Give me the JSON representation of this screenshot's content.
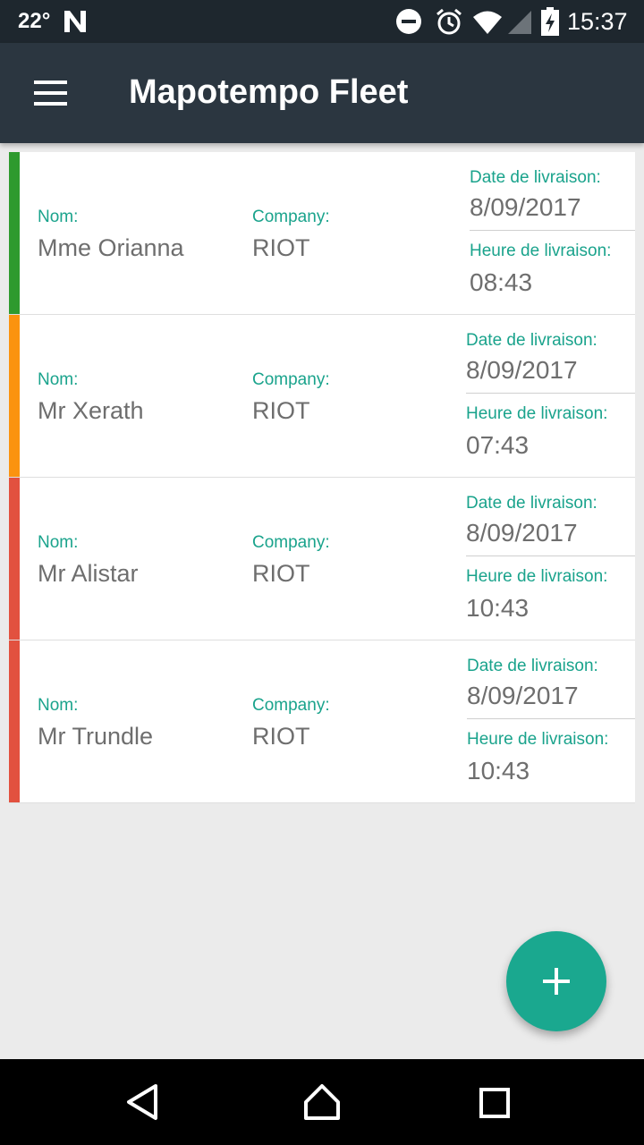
{
  "status_bar": {
    "temperature": "22°",
    "time": "15:37",
    "icons": [
      "n-icon",
      "do-not-disturb-icon",
      "alarm-icon",
      "wifi-icon",
      "signal-icon",
      "battery-charging-icon"
    ]
  },
  "app_bar": {
    "title": "Mapotempo Fleet",
    "menu_icon": "hamburger-menu-icon"
  },
  "colors": {
    "accent": "#1aa38c",
    "status_green": "#2e9a2e",
    "status_orange": "#fb930f",
    "status_red": "#e2513f",
    "app_bar": "#2b3640"
  },
  "labels": {
    "nom": "Nom:",
    "company": "Company:",
    "date": "Date de livraison:",
    "heure": "Heure de livraison:"
  },
  "deliveries": [
    {
      "name": "Mme Orianna",
      "company": "RIOT",
      "date": "8/09/2017",
      "time": "08:43",
      "status_color": "#2e9a2e"
    },
    {
      "name": "Mr Xerath",
      "company": "RIOT",
      "date": "8/09/2017",
      "time": "07:43",
      "status_color": "#fb930f"
    },
    {
      "name": "Mr Alistar",
      "company": "RIOT",
      "date": "8/09/2017",
      "time": "10:43",
      "status_color": "#e2513f"
    },
    {
      "name": "Mr Trundle",
      "company": "RIOT",
      "date": "8/09/2017",
      "time": "10:43",
      "status_color": "#e2513f"
    }
  ],
  "fab": {
    "icon": "add-icon"
  },
  "nav_bar": {
    "icons": [
      "back-icon",
      "home-icon",
      "recents-icon"
    ]
  }
}
